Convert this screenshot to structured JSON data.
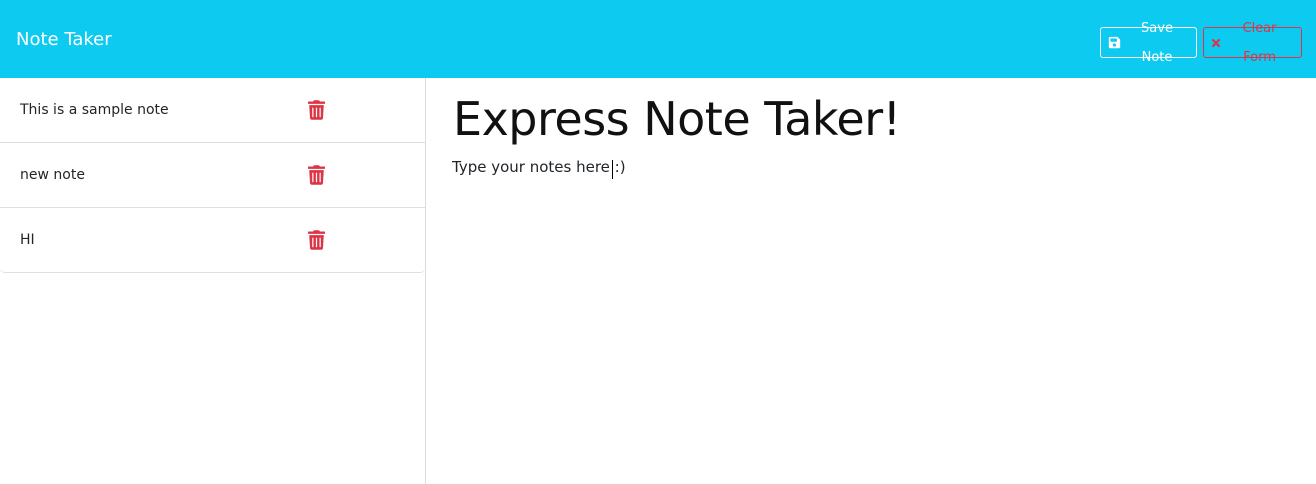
{
  "navbar": {
    "brand": "Note Taker",
    "save_label": "Save Note",
    "clear_label": "Clear Form",
    "save_icon": "floppy-disk-icon",
    "clear_icon": "x-icon",
    "background_color": "#0dcaf0",
    "danger_color": "#dc3545"
  },
  "notes": [
    {
      "title": "This is a sample note",
      "icon": "trash-icon"
    },
    {
      "title": "new note",
      "icon": "trash-icon"
    },
    {
      "title": "HI",
      "icon": "trash-icon"
    }
  ],
  "editor": {
    "title": "Express Note Taker!",
    "body": "Type your notes here :)"
  }
}
